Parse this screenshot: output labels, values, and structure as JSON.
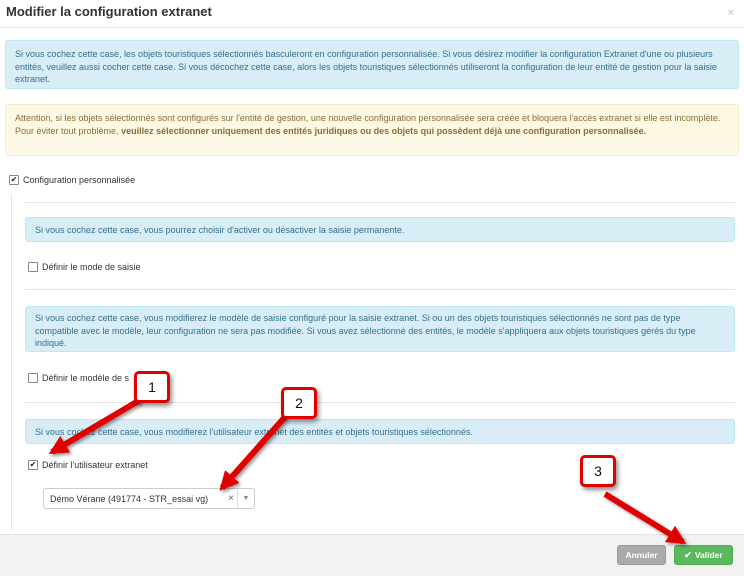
{
  "dialog": {
    "title": "Modifier la configuration extranet",
    "close_glyph": "×"
  },
  "info_main": "Si vous cochez cette case, les objets touristiques sélectionnés basculeront en configuration personnalisée. Si vous désirez modifier la configuration Extranet d'une ou plusieurs entités, veuillez aussi cocher cette case. Si vous décochez cette case, alors les objets touristiques sélectionnés utiliseront la configuration de leur entité de gestion pour la saisie extranet.",
  "warning": {
    "line1": "Attention, si les objets sélectionnés sont configurés sur l'entité de gestion, une nouvelle configuration personnalisée sera créée et bloquera l'accès extranet si elle est incomplète.",
    "line2_prefix": "Pour éviter tout problème, ",
    "line2_bold": "veuillez sélectionner uniquement des entités juridiques ou des objets qui possèdent déjà une configuration personnalisée."
  },
  "config_perso": {
    "label": "Configuration personnalisée",
    "checked": true
  },
  "section_mode": {
    "info": "Si vous cochez cette case, vous pourrez choisir d'activer ou désactiver la saisie permanente.",
    "label": "Définir le mode de saisie",
    "checked": false
  },
  "section_modele": {
    "info": "Si vous cochez cette case, vous modifierez le modèle de saisie configuré pour la saisie extranet. Si ou un des objets touristiques sélectionnés ne sont pas de type compatible avec le modèle, leur configuration ne sera pas modifiée. Si vous avez sélectionné des entités, le modèle s'appliquera aux objets touristiques gérés du type indiqué.",
    "label": "Définir le modèle de s",
    "checked": false
  },
  "section_user": {
    "info": "Si vous cochez cette case, vous modifierez l'utilisateur extranet des entités et objets touristiques sélectionnés.",
    "label": "Définir l'utilisateur extranet",
    "checked": true,
    "select_value": "Démo Vérane (491774 - STR_essai vg)",
    "clear_glyph": "×",
    "arrow_glyph": "▼"
  },
  "footer": {
    "cancel_label": "Annuler",
    "ok_label": "Valider",
    "ok_icon": "✔"
  },
  "annotations": {
    "badge1": "1",
    "badge2": "2",
    "badge3": "3",
    "color": "#e00000"
  },
  "check_glyph": "✔"
}
